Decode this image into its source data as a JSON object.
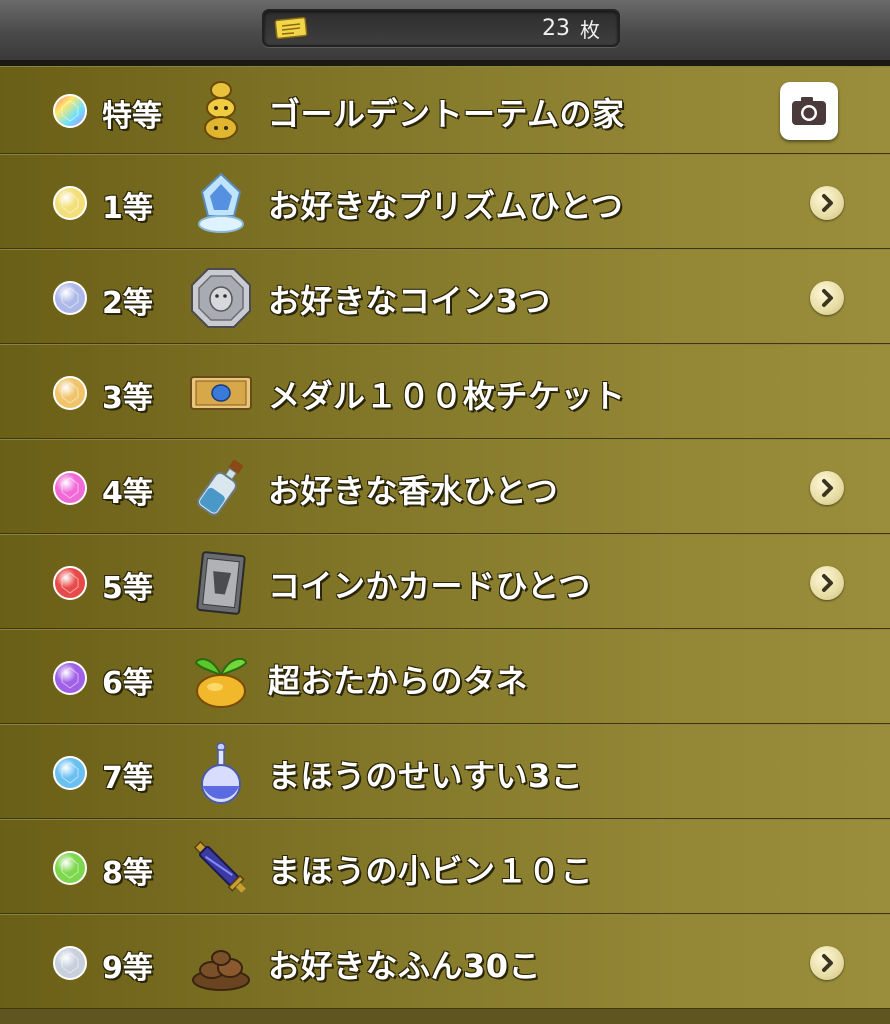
{
  "header": {
    "ticket_icon": "ticket-icon",
    "ticket_count": "23",
    "ticket_unit": "枚"
  },
  "prizes": [
    {
      "rank": "特等",
      "name": "ゴールデントーテムの家",
      "gem_color": "#d0a0ff",
      "icon": "golden-totem-icon",
      "action": "camera-icon"
    },
    {
      "rank": "1等",
      "name": "お好きなプリズムひとつ",
      "gem_color": "#f3df7a",
      "icon": "prism-crystal-icon",
      "action": "chevron-right-icon"
    },
    {
      "rank": "2等",
      "name": "お好きなコイン3つ",
      "gem_color": "#aeb9ea",
      "icon": "silver-coin-icon",
      "action": "chevron-right-icon"
    },
    {
      "rank": "3等",
      "name": "メダル１００枚チケット",
      "gem_color": "#f0c46a",
      "icon": "medal-ticket-icon",
      "action": ""
    },
    {
      "rank": "4等",
      "name": "お好きな香水ひとつ",
      "gem_color": "#f06ad8",
      "icon": "perfume-bottle-icon",
      "action": "chevron-right-icon"
    },
    {
      "rank": "5等",
      "name": "コインかカードひとつ",
      "gem_color": "#e84a4a",
      "icon": "card-icon",
      "action": "chevron-right-icon"
    },
    {
      "rank": "6等",
      "name": "超おたからのタネ",
      "gem_color": "#a060e8",
      "icon": "seed-sprout-icon",
      "action": ""
    },
    {
      "rank": "7等",
      "name": "まほうのせいすい3こ",
      "gem_color": "#6ac0f0",
      "icon": "holy-water-flask-icon",
      "action": ""
    },
    {
      "rank": "8等",
      "name": "まほうの小ビン１０こ",
      "gem_color": "#7ed84e",
      "icon": "magic-vial-icon",
      "action": ""
    },
    {
      "rank": "9等",
      "name": "お好きなふん30こ",
      "gem_color": "#c8d0dc",
      "icon": "dung-pile-icon",
      "action": "chevron-right-icon"
    }
  ]
}
